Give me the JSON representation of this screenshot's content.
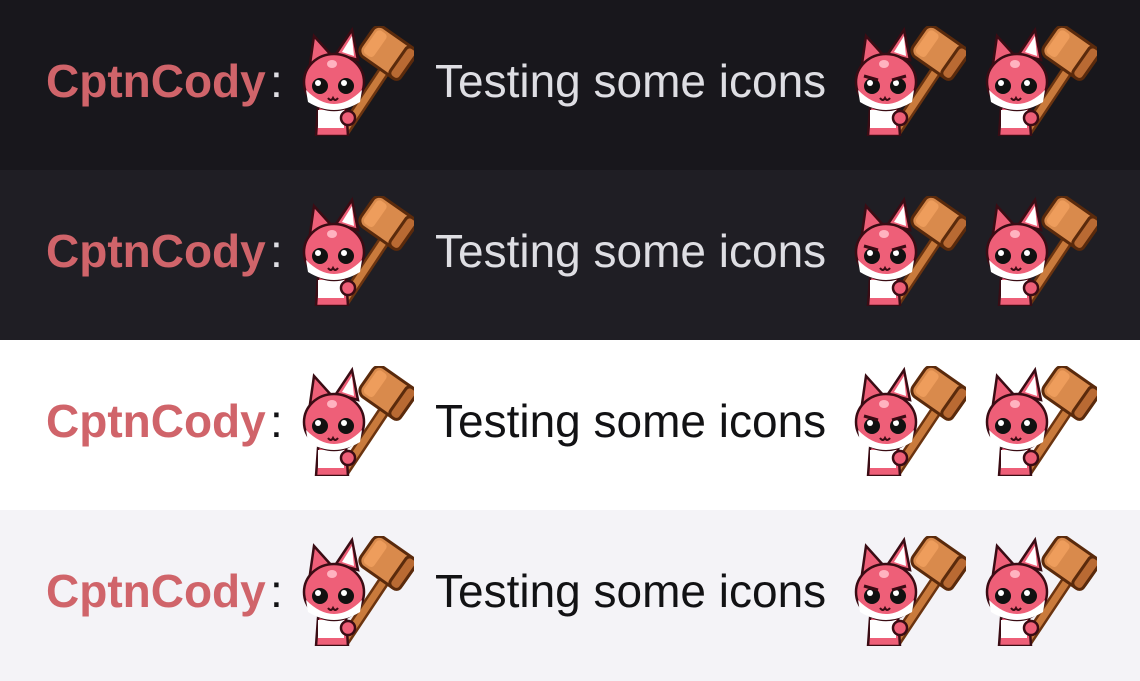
{
  "messages": [
    {
      "theme": "dark",
      "bg": "#18171c",
      "username": "CptnCody",
      "separator": ":",
      "text": "Testing some icons",
      "emotes": [
        "fox-hammer-emote",
        "fox-hammer-emote-angry",
        "fox-hammer-emote"
      ]
    },
    {
      "theme": "dark",
      "bg": "#1f1e24",
      "username": "CptnCody",
      "separator": ":",
      "text": "Testing some icons",
      "emotes": [
        "fox-hammer-emote",
        "fox-hammer-emote-angry",
        "fox-hammer-emote"
      ]
    },
    {
      "theme": "light",
      "bg": "#ffffff",
      "username": "CptnCody",
      "separator": ":",
      "text": "Testing some icons",
      "emotes": [
        "fox-hammer-emote",
        "fox-hammer-emote-angry",
        "fox-hammer-emote"
      ]
    },
    {
      "theme": "light",
      "bg": "#f4f3f7",
      "username": "CptnCody",
      "separator": ":",
      "text": "Testing some icons",
      "emotes": [
        "fox-hammer-emote",
        "fox-hammer-emote-angry",
        "fox-hammer-emote"
      ]
    }
  ],
  "colors": {
    "username": "#d0646a",
    "fox": "#ee5f78",
    "hammer": "#d88a4e"
  }
}
